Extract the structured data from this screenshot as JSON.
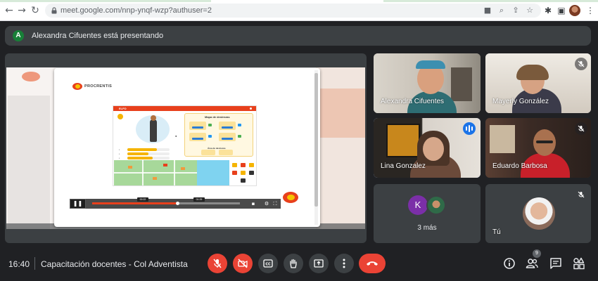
{
  "browser": {
    "url": "meet.google.com/nnp-ynqf-wzp?authuser=2"
  },
  "banner": {
    "avatar_letter": "A",
    "text": "Alexandra Cifuentes está presentando"
  },
  "presentation": {
    "brand_name": "PROCRENTIS",
    "game_title": "ELFO",
    "map_title": "Mapa de destrezas",
    "skills_subtitle": "Área de destrezas",
    "video": {
      "state": "paused",
      "progress_fraction": 0.58,
      "time_label_1": "00:22",
      "time_label_2": "01:29"
    }
  },
  "participants": [
    {
      "name": "Alexandra Cifuentes",
      "muted": false,
      "speaking": false
    },
    {
      "name": "Mayerly González",
      "muted": true,
      "speaking": false
    },
    {
      "name": "Lina Gonzalez",
      "muted": false,
      "speaking": true
    },
    {
      "name": "Eduardo Barbosa",
      "muted": true,
      "speaking": false
    }
  ],
  "more_tile": {
    "avatar_letter": "K",
    "label": "3 más"
  },
  "self_tile": {
    "name": "Tú",
    "muted": true
  },
  "bottom_bar": {
    "time": "16:40",
    "meeting_title": "Capacitación docentes - Col Adventista",
    "participants_count": "9"
  },
  "colors": {
    "background": "#202124",
    "tile": "#3c4043",
    "red_control": "#ea4335",
    "active_speaker": "#8ab4f8",
    "speaking_badge": "#1a73e8",
    "brand_orange": "#e8401c"
  },
  "icons": {
    "back": "arrow-back-icon",
    "forward": "arrow-forward-icon",
    "reload": "reload-icon",
    "lock": "lock-icon",
    "mic_off": "mic-off-icon",
    "camera_off": "videocam-off-icon",
    "captions": "closed-captions-icon",
    "raise_hand": "raise-hand-icon",
    "present": "present-screen-icon",
    "more": "more-vert-icon",
    "leave": "call-end-icon",
    "info": "info-icon",
    "people": "people-icon",
    "chat": "chat-icon",
    "activities": "activities-icon"
  }
}
